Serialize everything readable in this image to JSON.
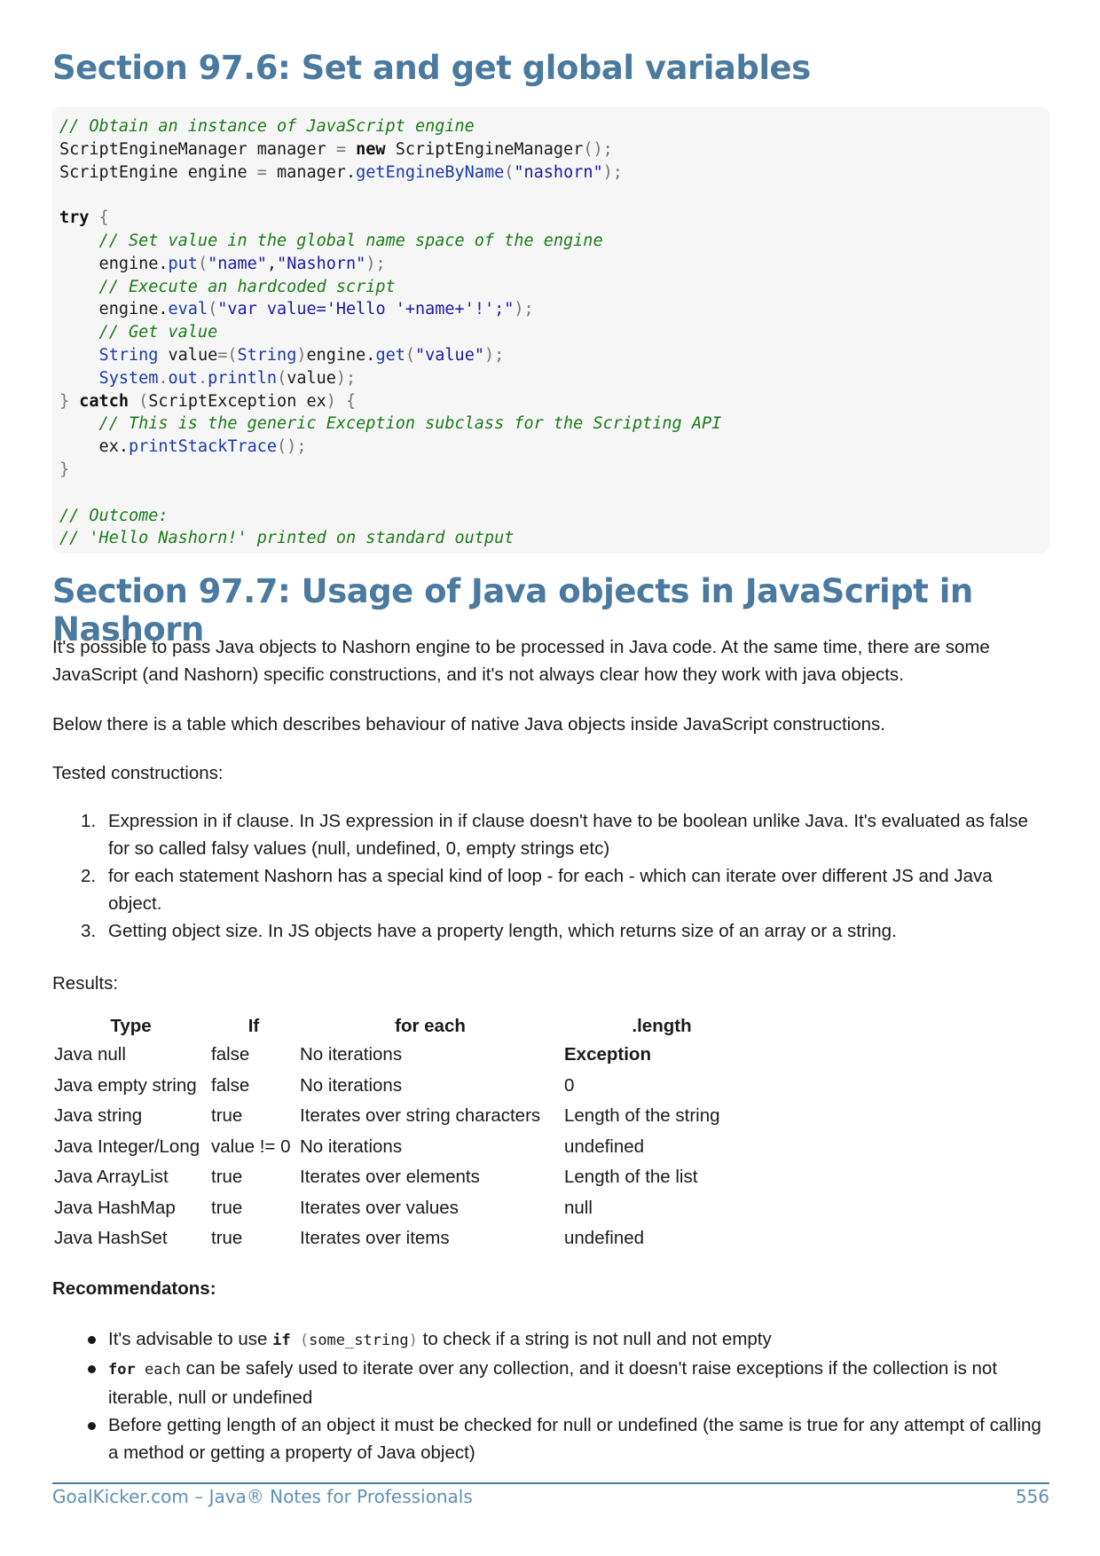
{
  "section1": {
    "title": "Section 97.6: Set and get global variables"
  },
  "code": {
    "l1": "// Obtain an instance of JavaScript engine",
    "l2a": "ScriptEngineManager manager ",
    "l2b": "= ",
    "l2c": "new",
    "l2d": " ScriptEngineManager",
    "l2e": "();",
    "l3a": "ScriptEngine engine ",
    "l3b": "= ",
    "l3c": "manager.",
    "l3d": "getEngineByName",
    "l3e": "(",
    "l3f": "\"nashorn\"",
    "l3g": ");",
    "l5a": "try",
    "l5b": " {",
    "l6": "    // Set value in the global name space of the engine",
    "l7a": "    engine.",
    "l7b": "put",
    "l7c": "(",
    "l7d": "\"name\"",
    "l7e": ",",
    "l7f": "\"Nashorn\"",
    "l7g": ");",
    "l8": "    // Execute an hardcoded script",
    "l9a": "    engine.",
    "l9b": "eval",
    "l9c": "(",
    "l9d": "\"var value='Hello '+name+'!';\"",
    "l9e": ");",
    "l10": "    // Get value",
    "l11a": "    String",
    "l11b": " value",
    "l11c": "=(",
    "l11d": "String",
    "l11e": ")",
    "l11f": "engine.",
    "l11g": "get",
    "l11h": "(",
    "l11i": "\"value\"",
    "l11j": ");",
    "l12a": "    System",
    "l12b": ".",
    "l12c": "out",
    "l12d": ".",
    "l12e": "println",
    "l12f": "(",
    "l12g": "value",
    "l12h": ");",
    "l13a": "} ",
    "l13b": "catch",
    "l13c": " (",
    "l13d": "ScriptException ex",
    "l13e": ") {",
    "l14": "    // This is the generic Exception subclass for the Scripting API",
    "l15a": "    ex.",
    "l15b": "printStackTrace",
    "l15c": "();",
    "l16": "}",
    "l18": "// Outcome:",
    "l19": "// 'Hello Nashorn!' printed on standard output"
  },
  "section2": {
    "title": "Section 97.7: Usage of Java objects in JavaScript in Nashorn",
    "p1": "It's possible to pass Java objects to Nashorn engine to be processed in Java code. At the same time, there are some JavaScript (and Nashorn) specific constructions, and it's not always clear how they work with java objects.",
    "p2": "Below there is a table which describes behaviour of native Java objects inside JavaScript constructions.",
    "p3": "Tested constructions:",
    "list": [
      {
        "num": "1.",
        "text": "Expression in if clause. In JS expression in if clause doesn't have to be boolean unlike Java. It's evaluated as false for so called falsy values (null, undefined, 0, empty strings etc)"
      },
      {
        "num": "2.",
        "text": "for each statement Nashorn has a special kind of loop - for each - which can iterate over different JS and Java object."
      },
      {
        "num": "3.",
        "text": "Getting object size. In JS objects have a property length, which returns size of an array or a string."
      }
    ],
    "p4": "Results:"
  },
  "table": {
    "headers": [
      "Type",
      "If",
      "for each",
      ".length"
    ],
    "rows": [
      [
        "Java null",
        "false",
        "No iterations",
        "Exception"
      ],
      [
        "Java empty string",
        "false",
        "No iterations",
        "0"
      ],
      [
        "Java string",
        "true",
        "Iterates over string characters",
        "Length of the string"
      ],
      [
        "Java Integer/Long",
        "value != 0",
        "No iterations",
        "undefined"
      ],
      [
        "Java ArrayList",
        "true",
        "Iterates over elements",
        "Length of the list"
      ],
      [
        "Java HashMap",
        "true",
        "Iterates over values",
        "null"
      ],
      [
        "Java HashSet",
        "true",
        "Iterates over items",
        "undefined"
      ]
    ]
  },
  "recs": {
    "title": "Recommendatons:",
    "r1a": "It's advisable to use ",
    "r1b": "if",
    "r1c": " (",
    "r1d": "some_string",
    "r1e": ")",
    "r1f": " to check if a string is not null and not empty",
    "r2a": "for",
    "r2b": " each",
    "r2c": " can be safely used to iterate over any collection, and it doesn't raise exceptions if the collection is not iterable, null or undefined",
    "r3": "Before getting length of an object it must be checked for null or undefined (the same is true for any attempt of calling a method or getting a property of Java object)"
  },
  "footer": {
    "left": "GoalKicker.com – Java® Notes for Professionals",
    "right": "556"
  }
}
